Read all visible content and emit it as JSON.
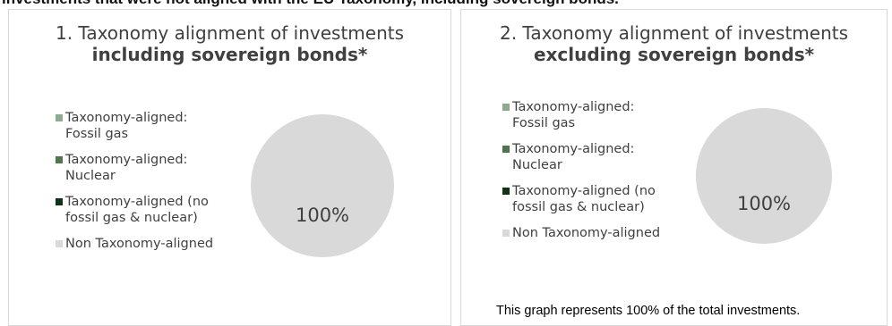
{
  "top_heading_clip": "investments that were not aligned with the EU Taxonomy, including sovereign bonds.",
  "legend": [
    {
      "label_line1": "Taxonomy-aligned:",
      "label_line2": "Fossil gas",
      "color": "#8faa8e"
    },
    {
      "label_line1": "Taxonomy-aligned:",
      "label_line2": "Nuclear",
      "color": "#4e7550"
    },
    {
      "label_line1": "Taxonomy-aligned (no",
      "label_line2": "fossil gas & nuclear)",
      "color": "#0f3314"
    },
    {
      "label_line1": "Non Taxonomy-aligned",
      "label_line2": "",
      "color": "#d9d9d9"
    }
  ],
  "panels": [
    {
      "title_line1": "1. Taxonomy alignment of investments",
      "title_line2": "including sovereign bonds*",
      "pie_label": "100%"
    },
    {
      "title_line1": "2. Taxonomy alignment of investments",
      "title_line2": "excluding sovereign bonds*",
      "pie_label": "100%"
    }
  ],
  "footnote": "This graph represents 100% of the total investments.",
  "chart_data": [
    {
      "type": "pie",
      "title": "1. Taxonomy alignment of investments including sovereign bonds*",
      "categories": [
        "Taxonomy-aligned: Fossil gas",
        "Taxonomy-aligned: Nuclear",
        "Taxonomy-aligned (no fossil gas & nuclear)",
        "Non Taxonomy-aligned"
      ],
      "values": [
        0,
        0,
        0,
        100
      ],
      "data_labels": [
        "",
        "",
        "",
        "100%"
      ],
      "legend_position": "left"
    },
    {
      "type": "pie",
      "title": "2. Taxonomy alignment of investments excluding sovereign bonds*",
      "categories": [
        "Taxonomy-aligned: Fossil gas",
        "Taxonomy-aligned: Nuclear",
        "Taxonomy-aligned (no fossil gas & nuclear)",
        "Non Taxonomy-aligned"
      ],
      "values": [
        0,
        0,
        0,
        100
      ],
      "data_labels": [
        "",
        "",
        "",
        "100%"
      ],
      "legend_position": "left"
    }
  ]
}
